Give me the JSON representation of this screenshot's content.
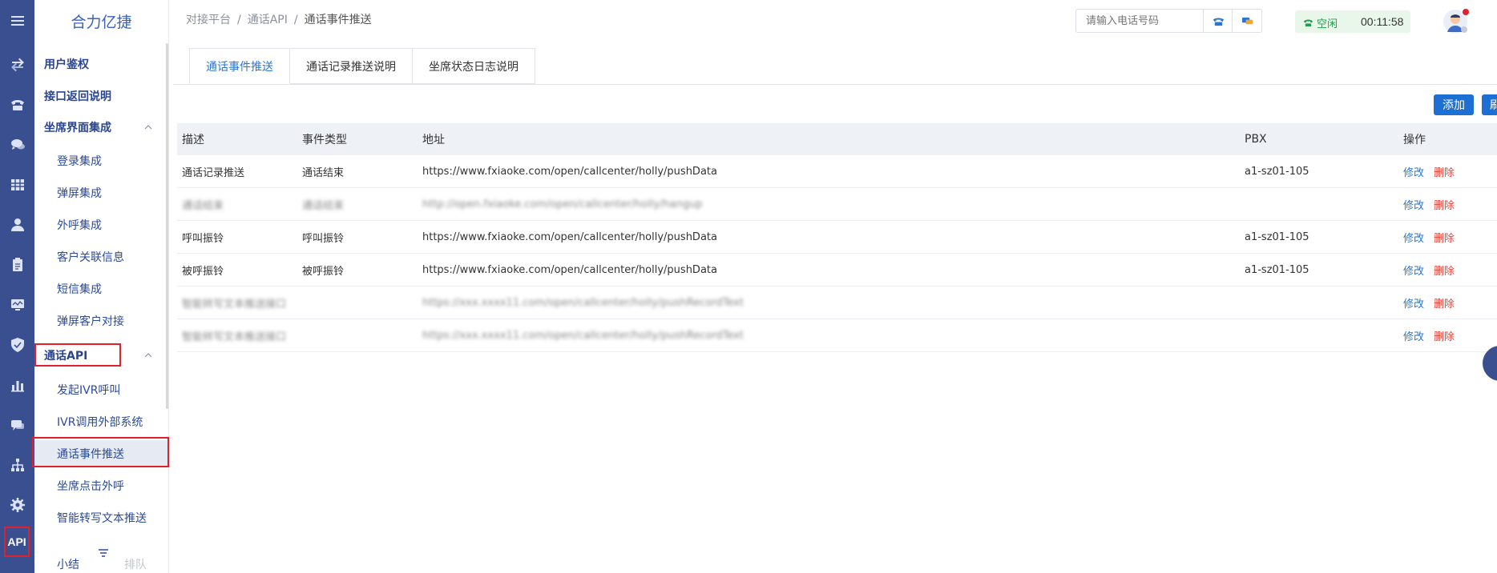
{
  "app": {
    "logo": "合力亿捷",
    "rail_api_label": "API"
  },
  "breadcrumb": [
    "对接平台",
    "通话API",
    "通话事件推送"
  ],
  "header": {
    "phone_placeholder": "请输入电话号码",
    "status_label": "空闲",
    "timer": "00:11:58"
  },
  "menu": {
    "items": [
      {
        "label": "用户鉴权"
      },
      {
        "label": "接口返回说明"
      },
      {
        "label": "坐席界面集成"
      },
      {
        "label": "登录集成"
      },
      {
        "label": "弹屏集成"
      },
      {
        "label": "外呼集成"
      },
      {
        "label": "客户关联信息"
      },
      {
        "label": "短信集成"
      },
      {
        "label": "弹屏客户对接"
      },
      {
        "label": "通话API"
      },
      {
        "label": "发起IVR呼叫"
      },
      {
        "label": "IVR调用外部系统"
      },
      {
        "label": "通话事件推送"
      },
      {
        "label": "坐席点击外呼"
      },
      {
        "label": "智能转写文本推送"
      }
    ],
    "bottom_left": "小结",
    "bottom_right": "排队"
  },
  "tabs": [
    {
      "label": "通话事件推送"
    },
    {
      "label": "通话记录推送说明"
    },
    {
      "label": "坐席状态日志说明"
    }
  ],
  "toolbar": {
    "add_label": "添加",
    "refresh_label": "刷"
  },
  "table": {
    "headers": [
      "描述",
      "事件类型",
      "地址",
      "PBX",
      "操作"
    ],
    "rows": [
      {
        "desc": "通话记录推送",
        "type": "通话结束",
        "url": "https://www.fxiaoke.com/open/callcenter/holly/pushData",
        "pbx": "a1-sz01-105",
        "edit": "修改",
        "del": "删除"
      },
      {
        "desc": "通话结束",
        "type": "通话结束",
        "url": "http://open.fxiaoke.com/open/callcenter/holly/hangup",
        "pbx": "",
        "edit": "修改",
        "del": "删除"
      },
      {
        "desc": "呼叫振铃",
        "type": "呼叫振铃",
        "url": "https://www.fxiaoke.com/open/callcenter/holly/pushData",
        "pbx": "a1-sz01-105",
        "edit": "修改",
        "del": "删除"
      },
      {
        "desc": "被呼振铃",
        "type": "被呼振铃",
        "url": "https://www.fxiaoke.com/open/callcenter/holly/pushData",
        "pbx": "a1-sz01-105",
        "edit": "修改",
        "del": "删除"
      },
      {
        "desc": "智能转写文本推送接口",
        "type": "",
        "url": "https://xxx.xxxx11.com/open/callcenter/holly/pushRecordText",
        "pbx": "",
        "edit": "修改",
        "del": "删除"
      },
      {
        "desc": "智能转写文本推送接口",
        "type": "",
        "url": "https://xxx.xxxx11.com/open/callcenter/holly/pushRecordText",
        "pbx": "",
        "edit": "修改",
        "del": "删除"
      }
    ]
  },
  "colors": {
    "rail": "#3a4f8f",
    "accent": "#1d6fd4",
    "link": "#2b76d1",
    "danger": "#e0473c",
    "highlight_box": "#e0202b"
  }
}
